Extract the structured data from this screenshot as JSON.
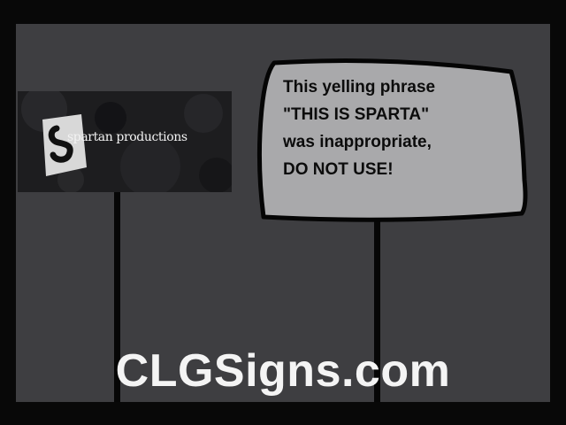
{
  "logo_sign": {
    "text": "spartan productions"
  },
  "warning_sign": {
    "lines": [
      "This yelling phrase",
      "\"THIS IS SPARTA\"",
      "was inappropriate,",
      "DO NOT USE!"
    ]
  },
  "footer": {
    "url": "CLGSigns.com"
  },
  "colors": {
    "background": "#3e3e41",
    "frame": "#080808",
    "sign_fill": "#a9a9ab",
    "sign_outline": "#050505",
    "logo_background": "#1d1d1f",
    "text_light": "#f4f4f4"
  },
  "icons": [
    "spartan-logo-emblem-icon"
  ]
}
